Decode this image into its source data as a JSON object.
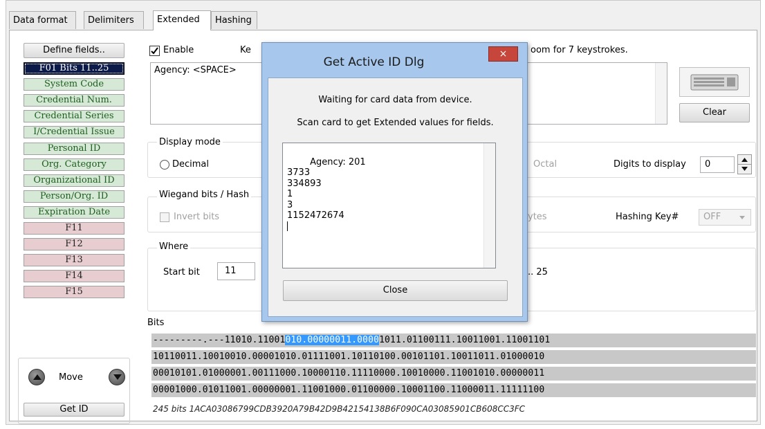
{
  "tabs": {
    "data_format": "Data format",
    "delimiters": "Delimiters",
    "extended": "Extended",
    "hashing": "Hashing"
  },
  "left": {
    "define_fields": "Define fields..",
    "fields": [
      {
        "label": "F01 Bits 11..25",
        "style": "selected"
      },
      {
        "label": "System Code",
        "style": "green"
      },
      {
        "label": "Credential Num.",
        "style": "green"
      },
      {
        "label": "Credential Series",
        "style": "green"
      },
      {
        "label": "I/Credential Issue",
        "style": "green"
      },
      {
        "label": "Personal ID",
        "style": "green"
      },
      {
        "label": "Org. Category",
        "style": "green"
      },
      {
        "label": "Organizational ID",
        "style": "green"
      },
      {
        "label": "Person/Org. ID",
        "style": "green"
      },
      {
        "label": "Expiration Date",
        "style": "green"
      },
      {
        "label": "F11",
        "style": "pink"
      },
      {
        "label": "F12",
        "style": "pink"
      },
      {
        "label": "F13",
        "style": "pink"
      },
      {
        "label": "F14",
        "style": "pink"
      },
      {
        "label": "F15",
        "style": "pink"
      }
    ],
    "move": "Move",
    "get_id": "Get ID"
  },
  "extended": {
    "enable_label": "Enable",
    "enable_checked": true,
    "keystrokes_partial": "Ke",
    "room_text": "oom for 7 keystrokes.",
    "text_value": "Agency: <SPACE>",
    "clear": "Clear",
    "display_mode_title": "Display mode",
    "decimal": "Decimal",
    "octal": "Octal",
    "digits_label": "Digits to display",
    "digits_value": "0",
    "wiegand_title": "Wiegand bits / Hash",
    "invert_bits": "Invert bits",
    "bytes_partial": "ytes",
    "hashing_key_label": "Hashing Key#",
    "hashing_key_value": "OFF",
    "where_title": "Where",
    "start_bit_label": "Start bit",
    "start_bit_value": "11",
    "range_end": ".. 25"
  },
  "bits": {
    "title": "Bits",
    "rows": [
      {
        "pre": "---------.---11010.11001",
        "hl": "010.00000011.0000",
        "post": "1011.01100111.10011001.11001101"
      },
      {
        "pre": "10110011.10010010.00001010.01111001.10110100.00101101.10011011.01000010",
        "hl": "",
        "post": ""
      },
      {
        "pre": "00010101.01000001.00111000.10000110.11110000.10010000.11001010.00000011",
        "hl": "",
        "post": ""
      },
      {
        "pre": "00001000.01011001.00000001.11001000.01100000.10001100.11000011.11111100",
        "hl": "",
        "post": ""
      }
    ],
    "summary": "245 bits 1ACA03086799CDB3920A79B42D9B42154138B6F090CA03085901CB608CC3FC"
  },
  "dialog": {
    "title": "Get Active ID Dlg",
    "close_x": "×",
    "line1": "Waiting for card data from device.",
    "line2": "Scan card to get Extended values for fields.",
    "output": "Agency: 201\n3733\n334893\n1\n3\n1152472674\n",
    "close_button": "Close"
  }
}
